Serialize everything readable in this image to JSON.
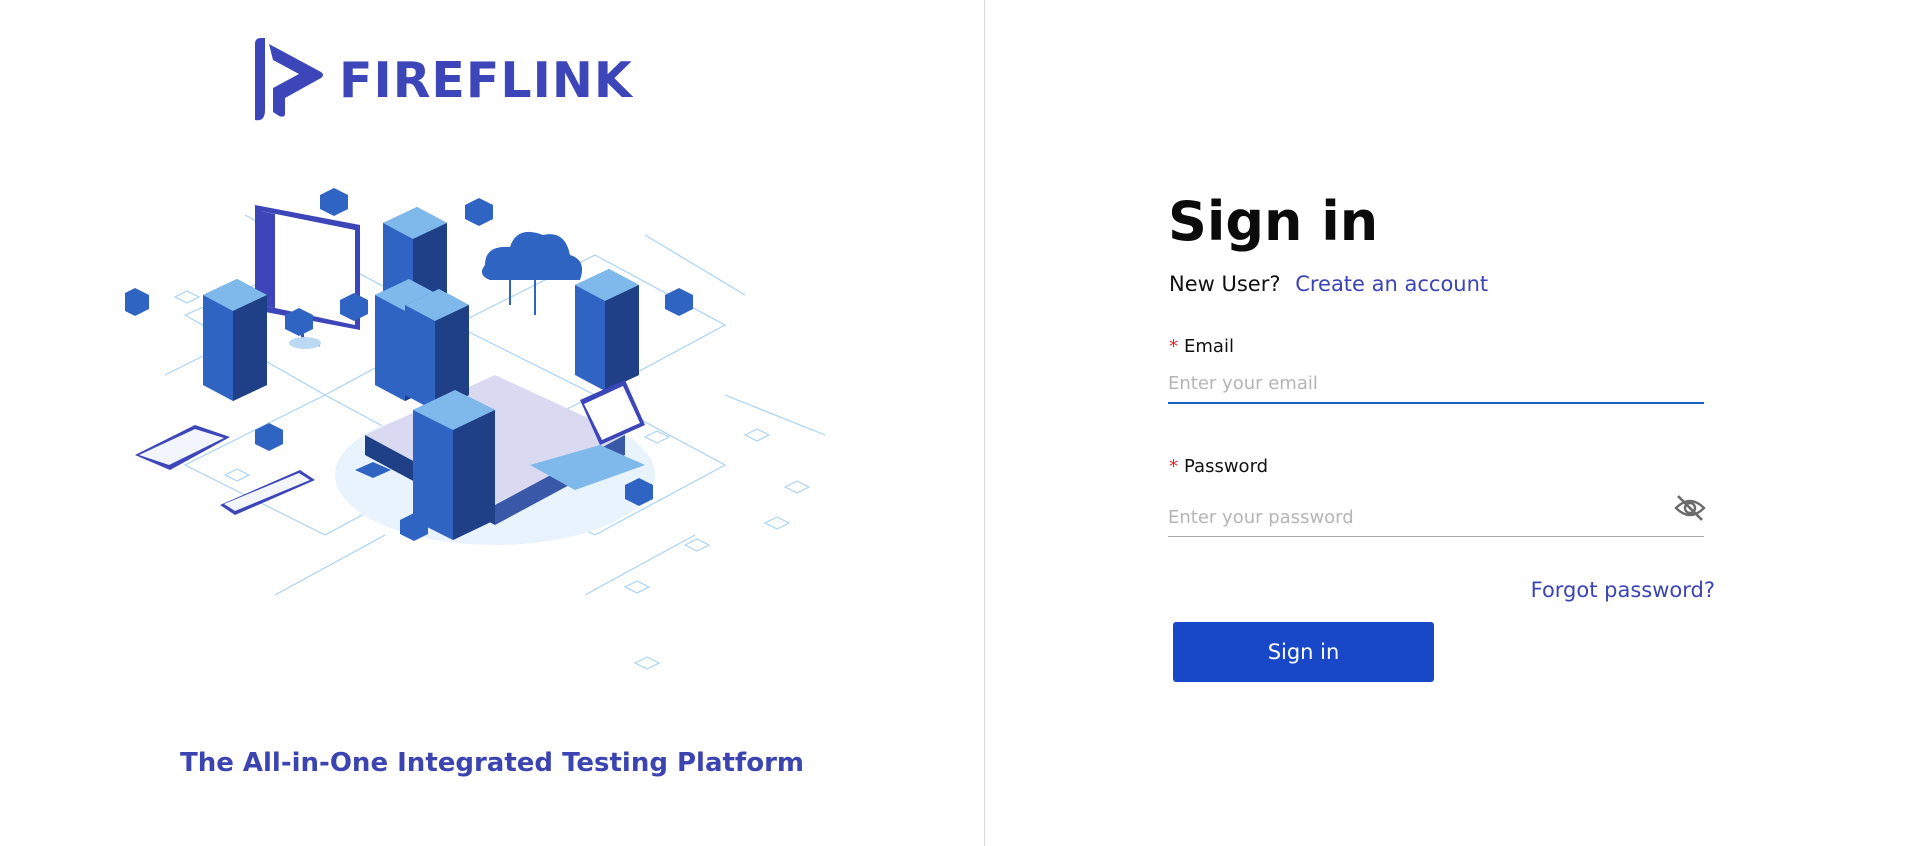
{
  "brand": {
    "name": "FIREFLINK",
    "tagline": "The All-in-One Integrated Testing Platform",
    "color": "#3d46b8"
  },
  "signin": {
    "title": "Sign in",
    "new_user_label": "New User?",
    "create_account_link": "Create an account",
    "email": {
      "required_mark": "*",
      "label": "Email",
      "placeholder": "Enter your email",
      "value": ""
    },
    "password": {
      "required_mark": "*",
      "label": "Password",
      "placeholder": "Enter your password",
      "value": ""
    },
    "forgot_password_link": "Forgot password?",
    "submit_label": "Sign in",
    "accent_color": "#1848c8",
    "link_color": "#3a44b5"
  },
  "icons": {
    "password_toggle": "eye-slash-icon",
    "logo": "fireflink-logo-icon"
  }
}
